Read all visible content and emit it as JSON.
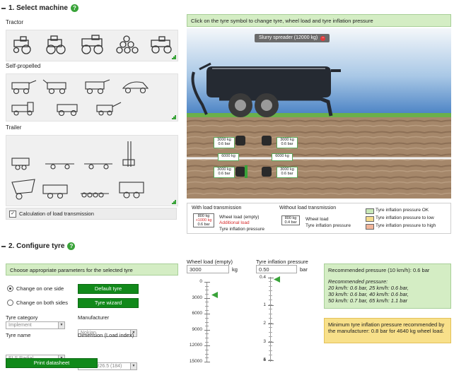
{
  "section1": {
    "title": "1. Select machine"
  },
  "categories": {
    "tractor": "Tractor",
    "self_propelled": "Self-propelled",
    "trailer": "Trailer"
  },
  "checkbox_load": {
    "label": "Calculation of load transmission"
  },
  "instruction": "Click on the tyre symbol to change tyre, wheel load and tyre inflation pressure",
  "machine_badge": "Slurry spreader (12000 kg)",
  "tyre_boxes": [
    {
      "l1": "3000 kg",
      "l2": "0.6 bar"
    },
    {
      "l1": "3000 kg",
      "l2": "0.6 bar"
    },
    {
      "l1": "6000 kg"
    },
    {
      "l1": "6000 kg"
    },
    {
      "l1": "3000 kg",
      "l2": "0.6 bar"
    },
    {
      "l1": "3000 kg",
      "l2": "0.6 bar"
    }
  ],
  "legend": {
    "with_title": "With load transmission",
    "ex_l1": "800 kg",
    "ex_l2": "+1000 kg",
    "ex_l3": "0.6 bar",
    "wheel_load_empty": "Wheel load (empty)",
    "additional_load": "Additional load",
    "tyre_pressure": "Tyre inflation pressure",
    "without_title": "Without load transmission",
    "ex2_l1": "800 kg",
    "ex2_l2": "0.4 bar",
    "wheel_load": "Wheel load",
    "tyre_pressure2": "Tyre inflation pressure",
    "status_ok": "Tyre inflation pressure OK",
    "status_low": "Tyre inflation pressure to low",
    "status_high": "Tyre inflation pressure to high",
    "colors": {
      "ok": "#c8e8b8",
      "low": "#f5dc8c",
      "high": "#f2b59a"
    }
  },
  "section2": {
    "title": "2. Configure tyre"
  },
  "params_header": "Choose appropriate parameters for the selected tyre",
  "change": {
    "one_side": "Change on one side",
    "both_sides": "Change on both sides",
    "default_tyre": "Default tyre",
    "tyre_wizard": "Tyre wizard"
  },
  "fields": {
    "tyre_category_label": "Tyre category",
    "tyre_category_value": "Implement",
    "manufacturer_label": "Manufacturer",
    "manufacturer_value": "Nokian",
    "tyre_name_label": "Tyre name",
    "tyre_name_value": "ELS Radial",
    "dimension_label": "Dimension (Load index)",
    "dimension_value": "750/65R26.5 (184)"
  },
  "print_datasheet": "Print datasheet",
  "wheel_load": {
    "label": "Wheel load (empty)",
    "value": "3000",
    "unit": "kg",
    "ticks": [
      "0",
      "3000",
      "6000",
      "9000",
      "12000",
      "15000"
    ],
    "level": 3000,
    "max": 15000
  },
  "inflation": {
    "label": "Tyre inflation pressure",
    "value": "0.50",
    "unit": "bar",
    "ticks": [
      "0.4",
      "1",
      "2",
      "3",
      "4",
      "5"
    ],
    "level": 0.5
  },
  "recommended": {
    "title": "Recommended pressure (10 km/h): 0.6 bar",
    "sub": "Recommended pressure:",
    "r1": "20 km/h: 0.6 bar, 25 km/h: 0.6 bar,",
    "r2": "30 km/h: 0.6 bar, 40 km/h: 0.6 bar,",
    "r3": "50 km/h: 0.7 bar, 65 km/h: 1.1 bar"
  },
  "minimum": "Minimum tyre inflation pressure recommended by the manufacturer: 0.8 bar for 4640 kg wheel load."
}
